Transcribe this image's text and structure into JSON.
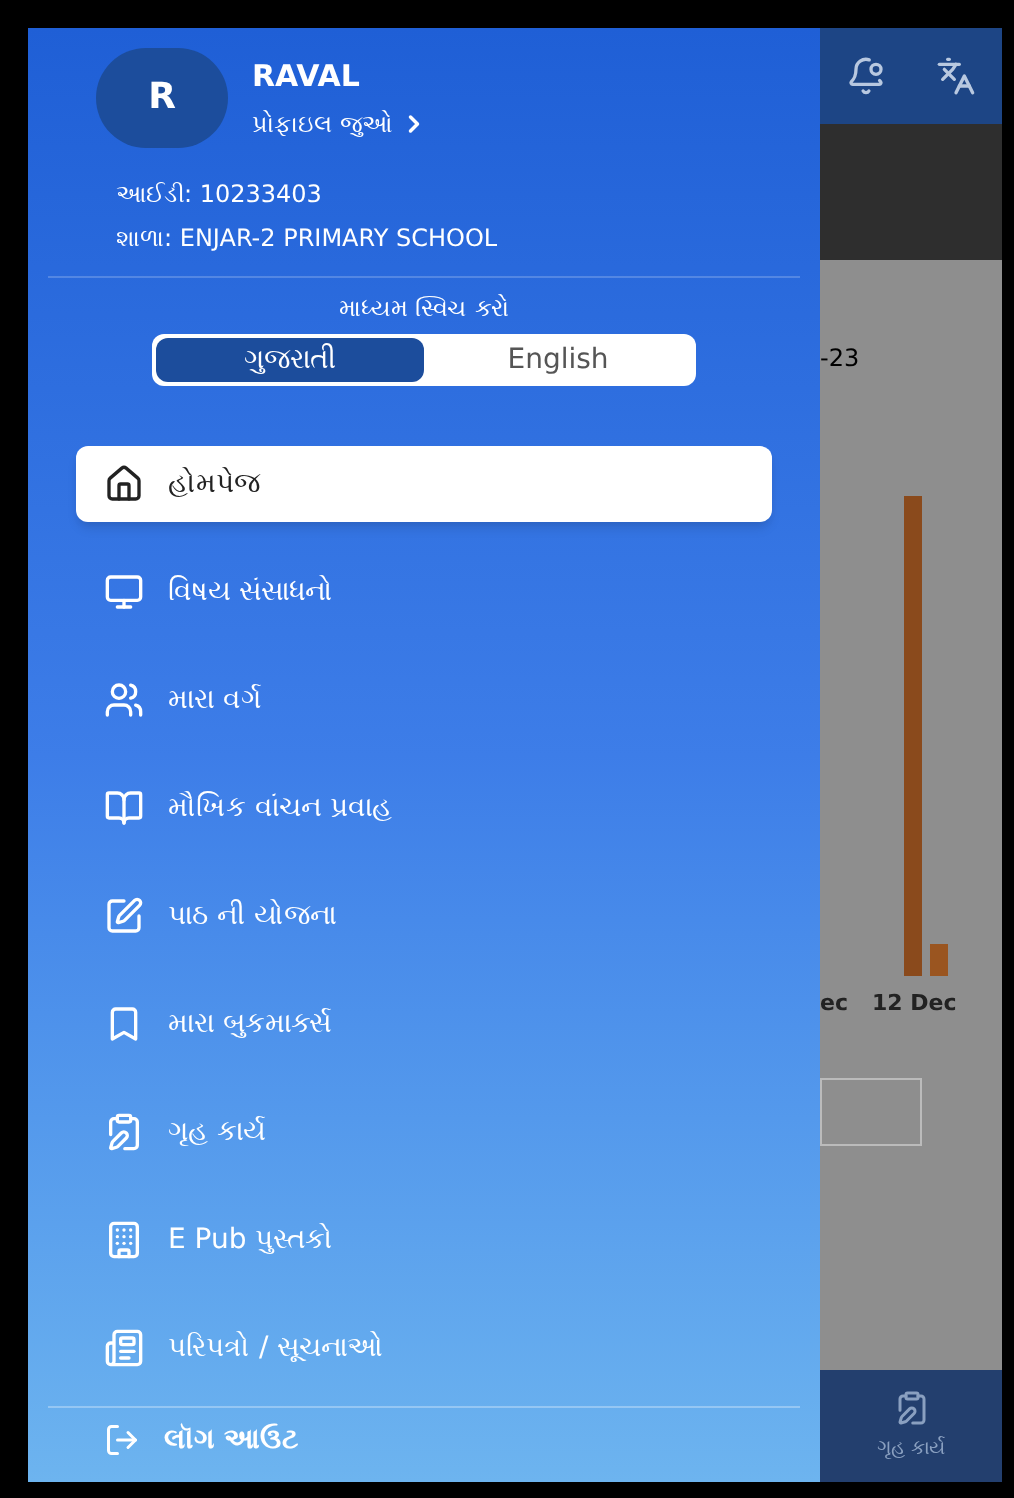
{
  "profile": {
    "initial": "R",
    "name": "RAVAL",
    "link": "પ્રોફાઇલ જુઓ",
    "id": "આઈડી: 10233403",
    "school": "શાળા: ENJAR-2 PRIMARY SCHOOL"
  },
  "medium": {
    "label": "માધ્યમ સ્વિચ કરો",
    "options": [
      {
        "label": "ગુજરાતી",
        "selected": true
      },
      {
        "label": "English",
        "selected": false
      }
    ]
  },
  "menu": [
    {
      "label": "હોમપેજ",
      "selected": true,
      "kind": "home"
    },
    {
      "label": "વિષય સંસાધનો",
      "selected": false,
      "kind": "monitor"
    },
    {
      "label": "મારા વર્ગ",
      "selected": false,
      "kind": "people"
    },
    {
      "label": "મૌખિક વાંચન પ્રવાહ",
      "selected": false,
      "kind": "book"
    },
    {
      "label": "પાઠ ની યોજના",
      "selected": false,
      "kind": "pen"
    },
    {
      "label": "મારા બુકમાર્ક્સ",
      "selected": false,
      "kind": "bookmark"
    },
    {
      "label": "ગૃહ કાર્ય",
      "selected": false,
      "kind": "homework"
    },
    {
      "label": "E Pub પુસ્તકો",
      "selected": false,
      "kind": "epub"
    },
    {
      "label": "પરિપત્રો / સૂચનાઓ",
      "selected": false,
      "kind": "notice"
    }
  ],
  "logout": {
    "label": "લૉગ આઉટ"
  },
  "background": {
    "date_fragment": "-23",
    "axis_labels": [
      "ec",
      "12 Dec"
    ],
    "bottom_nav_label": "ગૃહ કાર્ય"
  }
}
